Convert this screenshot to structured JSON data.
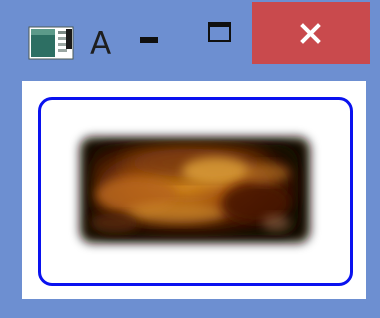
{
  "window": {
    "title": "A",
    "icon": "window-app-icon",
    "buttons": {
      "minimize": "minimize-icon",
      "maximize": "maximize-icon",
      "close": "close-icon"
    }
  },
  "content": {
    "image": "blurred-image",
    "border_color": "#0a12ef"
  },
  "colors": {
    "window_frame": "#6d8fd1",
    "close_button": "#c94a4d",
    "client_background": "#ffffff"
  }
}
